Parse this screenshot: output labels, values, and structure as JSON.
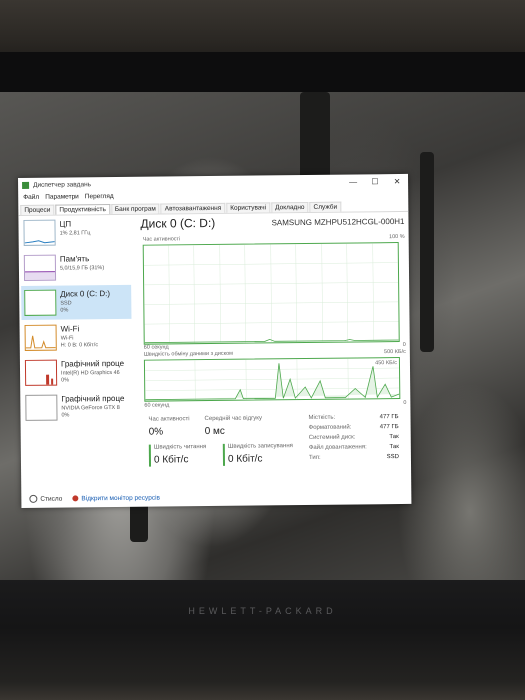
{
  "window": {
    "title": "Диспетчер завдань",
    "controls": {
      "minimize": "—",
      "maximize": "☐",
      "close": "✕"
    }
  },
  "menu": [
    "Файл",
    "Параметри",
    "Перегляд"
  ],
  "tabs": [
    {
      "label": "Процеси",
      "active": false
    },
    {
      "label": "Продуктивність",
      "active": true
    },
    {
      "label": "Банк програм",
      "active": false
    },
    {
      "label": "Автозавантаження",
      "active": false
    },
    {
      "label": "Користувачі",
      "active": false
    },
    {
      "label": "Докладно",
      "active": false
    },
    {
      "label": "Служби",
      "active": false
    }
  ],
  "sidebar": [
    {
      "name": "ЦП",
      "sub": "1% 2,81 ГГц",
      "sub2": ""
    },
    {
      "name": "Пам'ять",
      "sub": "5,0/15,9 ГБ (31%)",
      "sub2": ""
    },
    {
      "name": "Диск 0 (C: D:)",
      "sub": "SSD",
      "sub2": "0%"
    },
    {
      "name": "Wi-Fi",
      "sub": "Wi-Fi",
      "sub2": "Н: 0 В: 0 Кбіт/с"
    },
    {
      "name": "Графічний проце",
      "sub": "Intel(R) HD Graphics 46",
      "sub2": "0%"
    },
    {
      "name": "Графічний проце",
      "sub": "NVIDIA GeForce GTX 8",
      "sub2": "0%"
    }
  ],
  "disk": {
    "title": "Диск 0 (C: D:)",
    "model": "SAMSUNG MZHPU512HCGL-000H1",
    "graph1": {
      "label": "Час активності",
      "max": "100 %",
      "time": "60 секунд",
      "min": "0"
    },
    "graph2": {
      "label": "Швидкість обміну даними з диском",
      "max": "500 КБ/с",
      "inner_max": "450 КБ/с",
      "time": "60 секунд",
      "min": "0"
    },
    "stats": {
      "active_time": {
        "label": "Час активності",
        "value": "0%"
      },
      "avg_response": {
        "label": "Середній час відгуку",
        "value": "0 мс"
      },
      "read_speed": {
        "label": "Швидкість читання",
        "value": "0 Кбіт/с"
      },
      "write_speed": {
        "label": "Швидкість записування",
        "value": "0 Кбіт/с"
      }
    },
    "properties": [
      {
        "key": "Місткість:",
        "value": "477 ГБ"
      },
      {
        "key": "Форматований:",
        "value": "477 ГБ"
      },
      {
        "key": "Системний диск:",
        "value": "Так"
      },
      {
        "key": "Файл довантаження:",
        "value": "Так"
      },
      {
        "key": "Тип:",
        "value": "SSD"
      }
    ]
  },
  "footer": {
    "less": "Стисло",
    "monitor": "Відкрити монітор ресурсів"
  },
  "device": {
    "brand": "HEWLETT-PACKARD"
  }
}
